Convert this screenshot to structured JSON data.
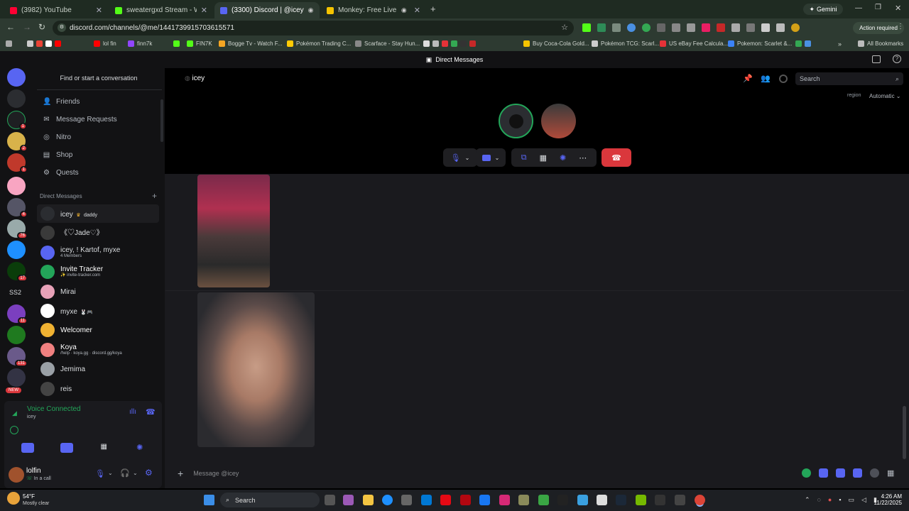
{
  "browser": {
    "tabs": [
      {
        "title": "(3982) YouTube",
        "color": "#ff0033"
      },
      {
        "title": "sweatergxd Stream - Watch Live",
        "color": "#53fc18"
      },
      {
        "title": "(3300) Discord | @icey",
        "color": "#5865f2"
      },
      {
        "title": "Monkey: Free Live Video Chat",
        "color": "#f5c400"
      }
    ],
    "gemini_label": "Gemini",
    "url": "discord.com/channels/@me/1441739915703615571",
    "action_required": "Action required",
    "all_bookmarks": "All Bookmarks",
    "bookmarks": [
      {
        "label": "lol fin",
        "color": "#ff0000"
      },
      {
        "label": "finn7k",
        "color": "#9146ff"
      },
      {
        "label": "FIN7K",
        "color": "#53fc18"
      },
      {
        "label": "Bogge Tv - Watch F...",
        "color": "#f5a623"
      },
      {
        "label": "Pokémon Trading C...",
        "color": "#ffcb05"
      },
      {
        "label": "Scarface - Stay Hun...",
        "color": "#888888"
      },
      {
        "label": "Buy Coca-Cola Gold...",
        "color": "#f5c400"
      },
      {
        "label": "Pokémon TCG: Scarl...",
        "color": "#cccccc"
      },
      {
        "label": "US eBay Fee Calcula...",
        "color": "#e53238"
      },
      {
        "label": "Pokemon: Scarlet &...",
        "color": "#3b82f6"
      }
    ]
  },
  "discord": {
    "top_title": "Direct Messages",
    "find_placeholder": "Find or start a conversation",
    "nav": [
      {
        "label": "Friends",
        "icon": "friends-icon"
      },
      {
        "label": "Message Requests",
        "icon": "mail-icon"
      },
      {
        "label": "Nitro",
        "icon": "nitro-icon"
      },
      {
        "label": "Shop",
        "icon": "shop-icon"
      },
      {
        "label": "Quests",
        "icon": "quests-icon"
      }
    ],
    "dm_header": "Direct Messages",
    "dms": [
      {
        "name": "icey",
        "sub": "",
        "tag": "daddy",
        "color": "#2b2d31"
      },
      {
        "name": "《♡Jade♡》",
        "sub": "",
        "tag": "",
        "color": "#3a3a3a"
      },
      {
        "name": "icey, ! Kartof, myxe",
        "sub": "4 Members",
        "tag": "",
        "color": "#5865f2"
      },
      {
        "name": "Invite Tracker",
        "sub": "✨ invite-tracker.com",
        "tag": "",
        "color": "#23a559"
      },
      {
        "name": "Mirai",
        "sub": "",
        "tag": "",
        "color": "#e8a2b8"
      },
      {
        "name": "myxe",
        "sub": "",
        "tag": "🐰🎮",
        "color": "#ffffff"
      },
      {
        "name": "Welcomer",
        "sub": "",
        "tag": "",
        "color": "#f0b232"
      },
      {
        "name": "Koya",
        "sub": "/help · koya.gg · discord.gg/koya",
        "tag": "",
        "color": "#f08080"
      },
      {
        "name": "Jemima",
        "sub": "",
        "tag": "",
        "color": "#9aa0a6"
      },
      {
        "name": "reis",
        "sub": "",
        "tag": "",
        "color": "#444444"
      }
    ],
    "guild_badges": [
      "1",
      "2",
      "1",
      "4",
      "76",
      "17",
      "11",
      "131"
    ],
    "ss2_label": "SS2",
    "new_label": "NEW",
    "voice_connected": "Voice Connected",
    "voice_channel": "icey",
    "user_name": "lolfin",
    "user_status": "In a call",
    "call_header_name": "icey",
    "search_placeholder": "Search",
    "region_label": "region",
    "region_value": "Automatic",
    "message_placeholder": "Message @icey"
  },
  "taskbar": {
    "weather_temp": "54°F",
    "weather_desc": "Mostly clear",
    "search_label": "Search",
    "time": "4:26 AM",
    "date": "11/22/2025"
  }
}
